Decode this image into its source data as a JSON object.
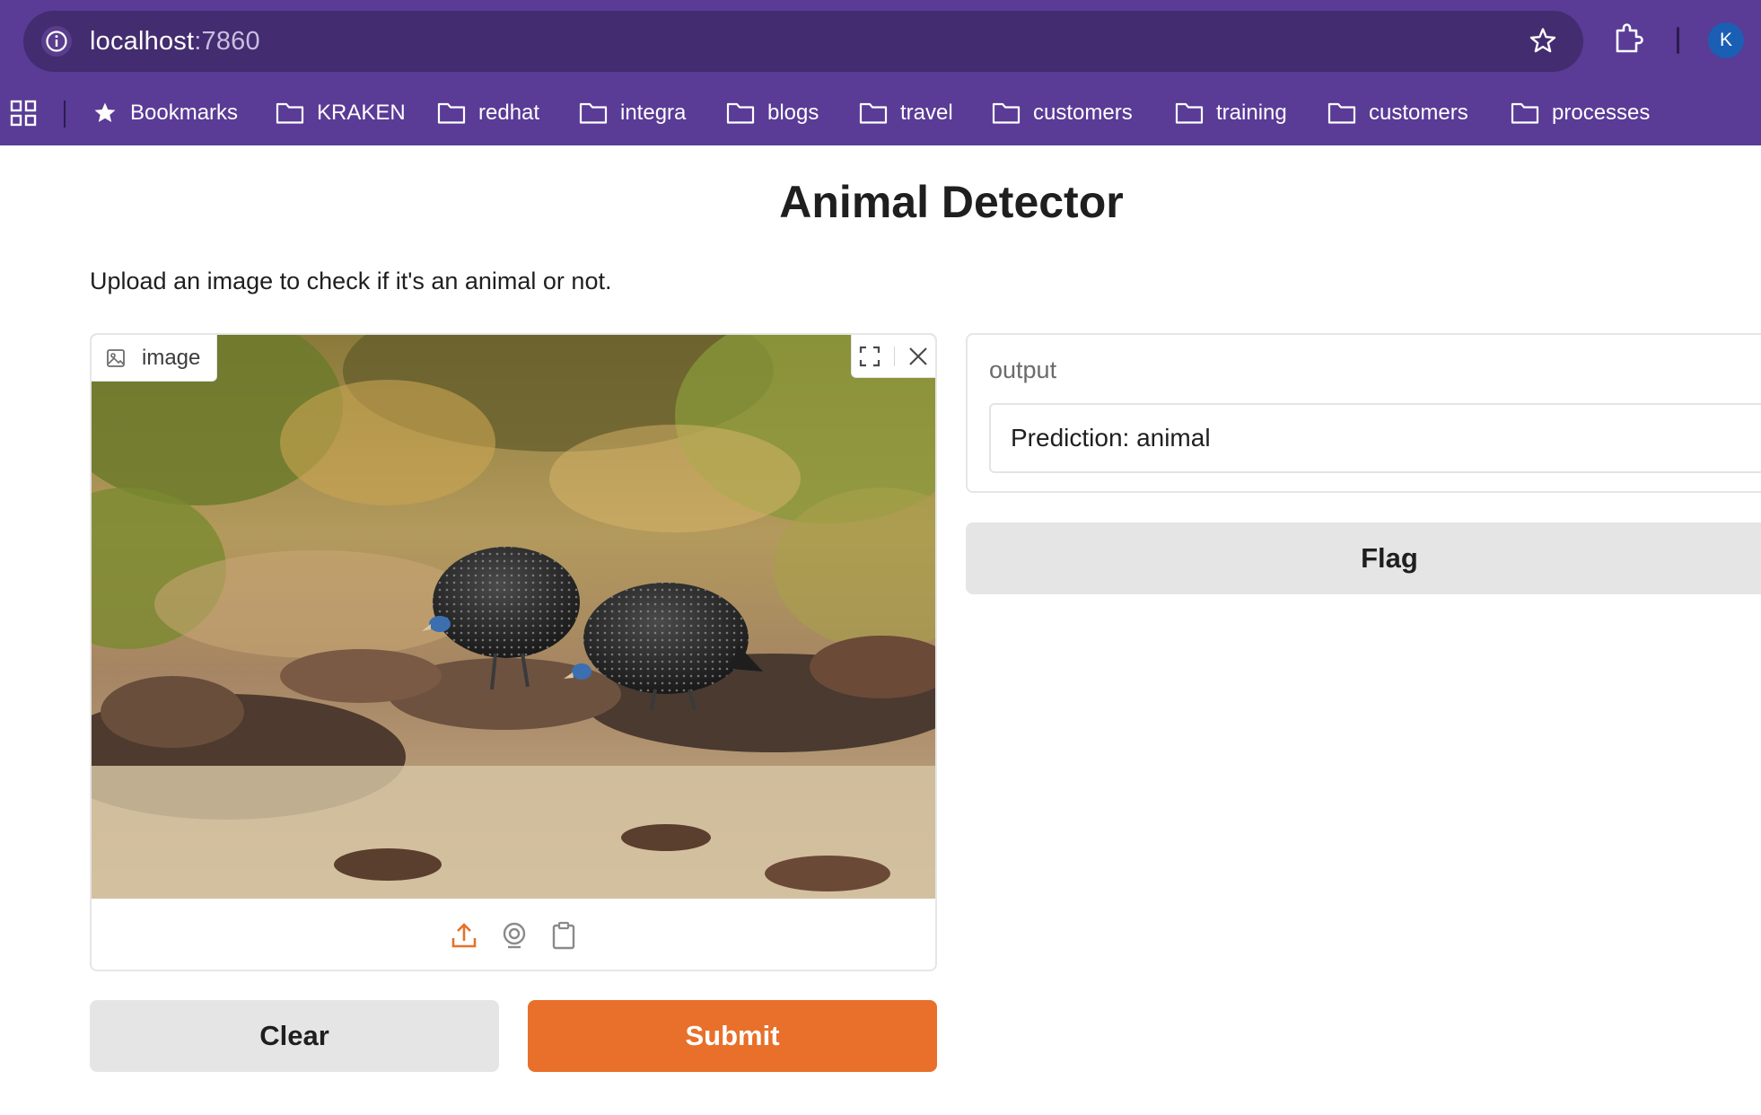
{
  "browser": {
    "url_host": "localhost",
    "url_port": ":7860",
    "profile_initial": "K",
    "bookmarks_label": "Bookmarks",
    "bookmark_folders": [
      "KRAKEN",
      "redhat",
      "integra",
      "blogs",
      "travel",
      "customers",
      "training",
      "customers",
      "processes"
    ]
  },
  "page": {
    "title": "Animal Detector",
    "description": "Upload an image to check if it's an animal or not."
  },
  "input": {
    "label": "image",
    "image_alt": "two guinea fowl foraging on dry ground"
  },
  "output": {
    "label": "output",
    "value": "Prediction: animal"
  },
  "buttons": {
    "clear": "Clear",
    "submit": "Submit",
    "flag": "Flag"
  },
  "colors": {
    "chrome": "#5a3b96",
    "omnibox": "#432c6f",
    "accent": "#e8702a",
    "secondary_button": "#e5e5e6"
  }
}
